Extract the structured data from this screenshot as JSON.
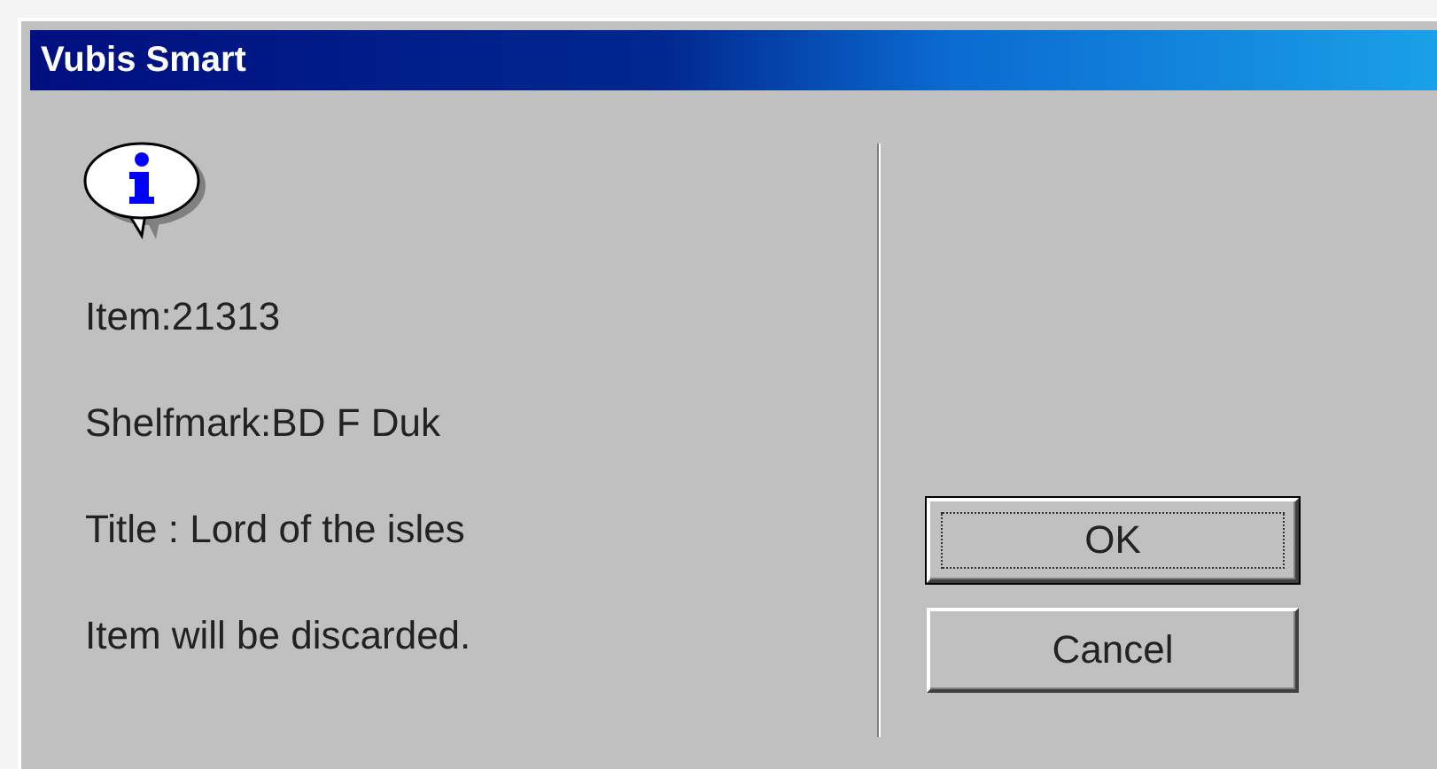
{
  "window": {
    "title": "Vubis Smart"
  },
  "message": {
    "kind": "info",
    "lines": [
      "Item:21313",
      "Shelfmark:BD F Duk",
      "Title : Lord of the isles",
      "Item will be discarded."
    ]
  },
  "buttons": [
    {
      "label": "OK",
      "focused": true
    },
    {
      "label": "Cancel",
      "focused": false
    }
  ]
}
